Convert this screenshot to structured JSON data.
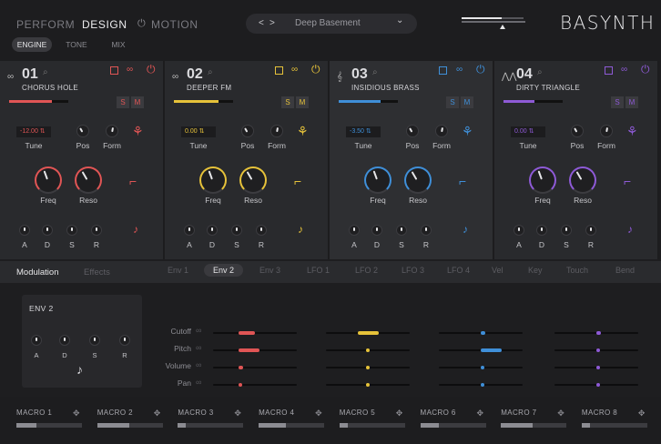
{
  "nav": {
    "tabs": [
      "PERFORM",
      "DESIGN",
      "MOTION"
    ],
    "active": "DESIGN"
  },
  "subtabs": [
    "ENGINE",
    "TONE",
    "MIX"
  ],
  "preset": {
    "prev": "<",
    "next": ">",
    "name": "Deep Basement",
    "caret": "⌄"
  },
  "brand": "BASYNTH",
  "oscillators": [
    {
      "num": "01",
      "name": "CHORUS HOLE",
      "color": "#e05555",
      "tune": "-12.00",
      "level": 0.72,
      "wave": "sine-pair-icon"
    },
    {
      "num": "02",
      "name": "DEEPER FM",
      "color": "#e6c23a",
      "tune": "0.00",
      "level": 0.75,
      "wave": "sine-pair-icon"
    },
    {
      "num": "03",
      "name": "INSIDIOUS BRASS",
      "color": "#3f8fd8",
      "tune": "-3.50",
      "level": 0.7,
      "wave": "horn-icon"
    },
    {
      "num": "04",
      "name": "DIRTY TRIANGLE",
      "color": "#8e5ad6",
      "tune": "0.00",
      "level": 0.52,
      "wave": "triangle-wave-icon"
    }
  ],
  "osc_labels": {
    "tune": "Tune",
    "pos": "Pos",
    "form": "Form",
    "freq": "Freq",
    "reso": "Reso",
    "a": "A",
    "d": "D",
    "s": "S",
    "r": "R",
    "solo": "S",
    "mute": "M"
  },
  "mod": {
    "tabs_left": [
      "Modulation",
      "Effects"
    ],
    "sources": [
      "Env 1",
      "Env 2",
      "Env 3",
      "LFO 1",
      "LFO 2",
      "LFO 3",
      "LFO 4",
      "Vel",
      "Key",
      "Touch",
      "Bend"
    ],
    "active_source": "Env 2",
    "env_title": "ENV 2",
    "env_labels": [
      "A",
      "D",
      "S",
      "R"
    ],
    "targets": [
      "Cutoff",
      "Pitch",
      "Volume",
      "Pan"
    ],
    "amounts": [
      [
        0.4,
        0.5,
        0.1,
        0.1
      ],
      [
        0.5,
        0.05,
        0.5,
        0.05
      ],
      [
        0.1,
        0.05,
        0.05,
        0.05
      ],
      [
        0.05,
        0.05,
        0.05,
        0.05
      ]
    ]
  },
  "macros": [
    {
      "label": "MACRO 1",
      "value": 0.3
    },
    {
      "label": "MACRO 2",
      "value": 0.48
    },
    {
      "label": "MACRO 3",
      "value": 0.12
    },
    {
      "label": "MACRO 4",
      "value": 0.42
    },
    {
      "label": "MACRO 5",
      "value": 0.12
    },
    {
      "label": "MACRO 6",
      "value": 0.28
    },
    {
      "label": "MACRO 7",
      "value": 0.48
    },
    {
      "label": "MACRO 8",
      "value": 0.12
    }
  ]
}
